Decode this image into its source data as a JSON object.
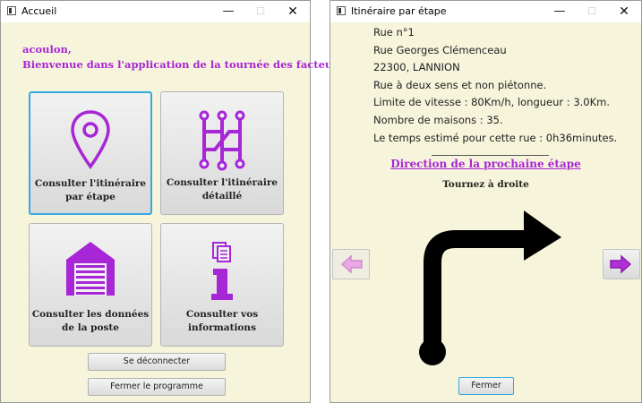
{
  "left_window": {
    "title": "Accueil",
    "welcome_user": "acoulon,",
    "welcome_message": "Bienvenue dans l'application de la tournée des facteurs !",
    "tiles": [
      {
        "line1": "Consulter l'itinéraire",
        "line2": "par étape",
        "icon": "map-pin-icon"
      },
      {
        "line1": "Consulter l'itinéraire",
        "line2": "détaillé",
        "icon": "route-icon"
      },
      {
        "line1": "Consulter les données",
        "line2": "de la poste",
        "icon": "garage-icon"
      },
      {
        "line1": "Consulter vos",
        "line2": "informations",
        "icon": "info-icon"
      }
    ],
    "logout_label": "Se déconnecter",
    "quit_label": "Fermer le programme"
  },
  "right_window": {
    "title": "Itinéraire par étape",
    "info_lines": [
      "Rue n°1",
      "Rue Georges Clémenceau",
      "22300, LANNION",
      "Rue à deux sens et non piétonne.",
      "Limite de vitesse : 80Km/h, longueur : 3.0Km.",
      "Nombre de maisons : 35.",
      "Le temps estimé pour cette rue : 0h36minutes."
    ],
    "direction_title": "Direction de la prochaine étape",
    "direction_text": "Tournez à droite",
    "close_label": "Fermer"
  },
  "colors": {
    "accent": "#a726d6",
    "background": "#f7f4dc",
    "focus": "#36a9e1"
  }
}
